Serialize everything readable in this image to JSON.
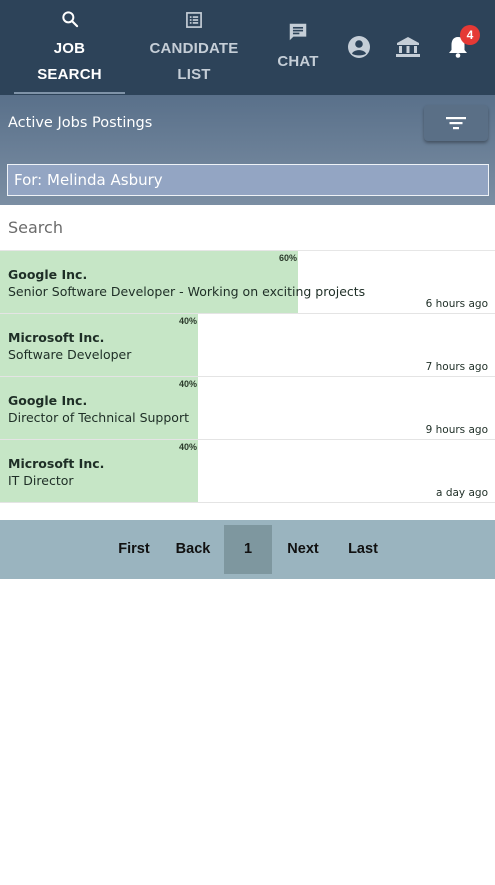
{
  "nav": {
    "tabs": [
      {
        "line1": "JOB",
        "line2": "SEARCH",
        "icon": "search-icon",
        "active": true
      },
      {
        "line1": "CANDIDATE",
        "line2": "LIST",
        "icon": "list-icon",
        "active": false
      },
      {
        "line1": "CHAT",
        "icon": "chat-icon",
        "active": false
      }
    ],
    "notification_count": "4",
    "icons": [
      "account-icon",
      "bank-icon",
      "bell-icon"
    ]
  },
  "header": {
    "title": "Active Jobs Postings",
    "for_value": "For: Melinda Asbury"
  },
  "search": {
    "placeholder": "Search"
  },
  "jobs": [
    {
      "company": "Google Inc.",
      "title": "Senior Software Developer - Working on exciting projects",
      "match": "60%",
      "match_value": 60,
      "posted": "6 hours ago"
    },
    {
      "company": "Microsoft Inc.",
      "title": "Software Developer",
      "match": "40%",
      "match_value": 40,
      "posted": "7 hours ago"
    },
    {
      "company": "Google Inc.",
      "title": "Director of Technical Support",
      "match": "40%",
      "match_value": 40,
      "posted": "9 hours ago"
    },
    {
      "company": "Microsoft Inc.",
      "title": "IT Director",
      "match": "40%",
      "match_value": 40,
      "posted": "a day ago"
    }
  ],
  "pagination": {
    "first": "First",
    "back": "Back",
    "current": "1",
    "next": "Next",
    "last": "Last"
  },
  "colors": {
    "nav_bg": "#2d4359",
    "match_fill": "#c6e6c6",
    "badge": "#e53935",
    "pager_bg": "#9ab4bf"
  }
}
